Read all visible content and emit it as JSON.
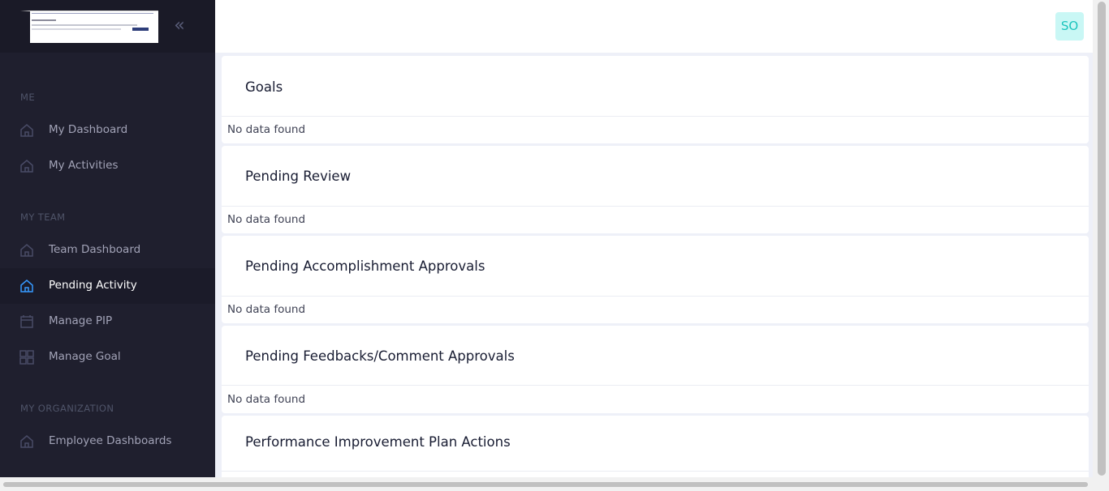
{
  "sidebar": {
    "collapse_glyph": "«",
    "sections": {
      "me": "ME",
      "my_team": "MY TEAM",
      "my_organization": "MY ORGANIZATION"
    },
    "items": [
      {
        "label": "My Dashboard",
        "icon": "home-icon",
        "active": false
      },
      {
        "label": "My Activities",
        "icon": "home-icon",
        "active": false
      },
      {
        "label": "Team Dashboard",
        "icon": "home-icon",
        "active": false
      },
      {
        "label": "Pending Activity",
        "icon": "home-icon",
        "active": true
      },
      {
        "label": "Manage PIP",
        "icon": "calendar-icon",
        "active": false
      },
      {
        "label": "Manage Goal",
        "icon": "grid-icon",
        "active": false
      },
      {
        "label": "Employee Dashboards",
        "icon": "home-icon",
        "active": false
      }
    ]
  },
  "header": {
    "avatar_initials": "SO"
  },
  "cards": [
    {
      "title": "Goals",
      "empty_text": "No data found"
    },
    {
      "title": "Pending Review",
      "empty_text": "No data found"
    },
    {
      "title": "Pending Accomplishment Approvals",
      "empty_text": "No data found"
    },
    {
      "title": "Pending Feedbacks/Comment Approvals",
      "empty_text": "No data found"
    },
    {
      "title": "Performance Improvement Plan Actions"
    }
  ],
  "colors": {
    "sidebar_bg": "#1f1f2e",
    "active_icon": "#3699ff",
    "avatar_bg": "#c9f7f5",
    "avatar_text": "#1bc5bd"
  }
}
